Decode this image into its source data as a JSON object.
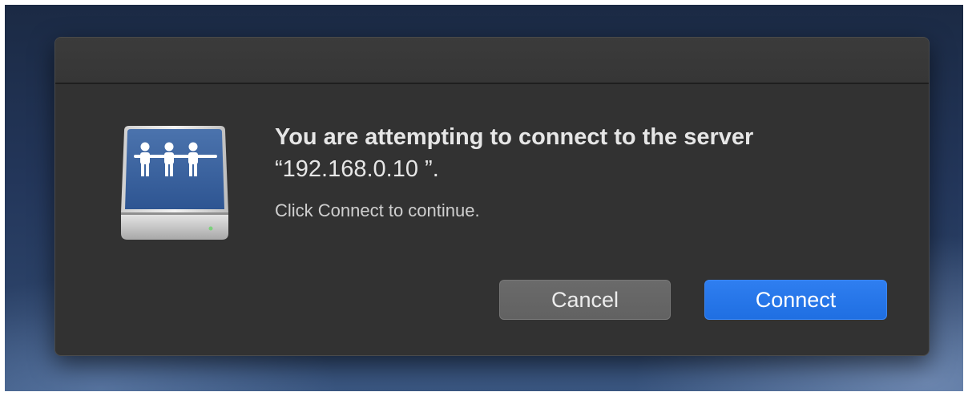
{
  "dialog": {
    "title_line1": "You are attempting to connect to the server",
    "server_address_quoted": "“192.168.0.10 ”.",
    "subtitle": "Click Connect to continue."
  },
  "buttons": {
    "cancel_label": "Cancel",
    "connect_label": "Connect"
  },
  "colors": {
    "dialog_bg": "#323232",
    "accent_blue": "#1f6fe2",
    "cancel_gray": "#666666"
  },
  "icon": {
    "name": "network-server-icon"
  }
}
